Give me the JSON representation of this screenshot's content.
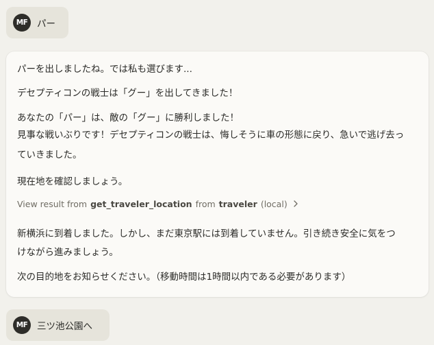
{
  "conversation": {
    "user_avatar_initials": "MF",
    "first_user_message": "パー",
    "assistant": {
      "paragraph_1": "パーを出しましたね。では私も選びます...",
      "paragraph_2": "デセプティコンの戦士は「グー」を出してきました！",
      "paragraph_3_line_1": "あなたの「パー」は、敵の「グー」に勝利しました！",
      "paragraph_3_line_2": "見事な戦いぶりです！デセプティコンの戦士は、悔しそうに車の形態に戻り、急いで逃げ去っ",
      "paragraph_3_line_3": "ていきました。",
      "paragraph_4": "現在地を確認しましょう。",
      "tool_result": {
        "prefix": "View result from",
        "tool_name": "get_traveler_location",
        "from_word": "from",
        "server_name": "traveler",
        "scope": "(local)",
        "chevron_icon": "chevron-right-icon"
      },
      "paragraph_5_line_1": "新横浜に到着しました。しかし、まだ東京駅には到着していません。引き続き安全に気をつ",
      "paragraph_5_line_2": "けながら進みましょう。",
      "paragraph_6": "次の目的地をお知らせください。（移動時間は1時間以内である必要があります）"
    },
    "second_user_message": "三ツ池公園へ"
  }
}
